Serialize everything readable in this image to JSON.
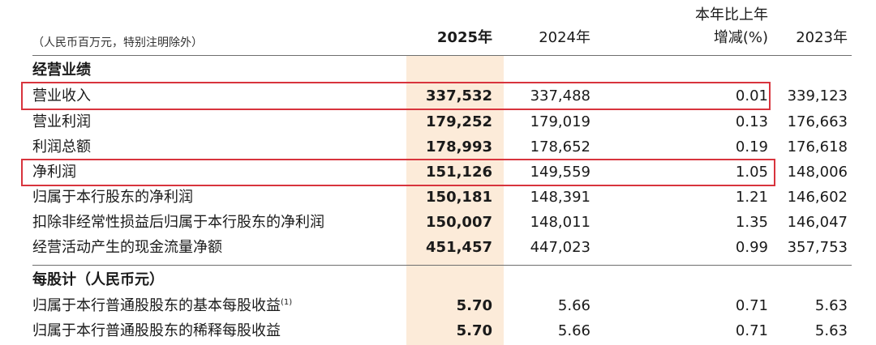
{
  "header": {
    "unit_note": "（人民币百万元，特别注明除外）",
    "col_2025": "2025年",
    "col_2024": "2024年",
    "col_change_line1": "本年比上年",
    "col_change_line2": "增减(%)",
    "col_2023": "2023年"
  },
  "sections": {
    "operating": "经营业绩",
    "per_share": "每股计（人民币元）"
  },
  "rows": [
    {
      "label": "营业收入",
      "v2025": "337,532",
      "v2024": "337,488",
      "change": "0.01",
      "v2023": "339,123"
    },
    {
      "label": "营业利润",
      "v2025": "179,252",
      "v2024": "179,019",
      "change": "0.13",
      "v2023": "176,663"
    },
    {
      "label": "利润总额",
      "v2025": "178,993",
      "v2024": "178,652",
      "change": "0.19",
      "v2023": "176,618"
    },
    {
      "label": "净利润",
      "v2025": "151,126",
      "v2024": "149,559",
      "change": "1.05",
      "v2023": "148,006"
    },
    {
      "label": "归属于本行股东的净利润",
      "v2025": "150,181",
      "v2024": "148,391",
      "change": "1.21",
      "v2023": "146,602"
    },
    {
      "label": "扣除非经常性损益后归属于本行股东的净利润",
      "v2025": "150,007",
      "v2024": "148,011",
      "change": "1.35",
      "v2023": "146,047"
    },
    {
      "label": "经营活动产生的现金流量净额",
      "v2025": "451,457",
      "v2024": "447,023",
      "change": "0.99",
      "v2023": "357,753"
    }
  ],
  "per_share_rows": [
    {
      "label": "归属于本行普通股股东的基本每股收益",
      "footnote": "(1)",
      "v2025": "5.70",
      "v2024": "5.66",
      "change": "0.71",
      "v2023": "5.63"
    },
    {
      "label": "归属于本行普通股股东的稀释每股收益",
      "v2025": "5.70",
      "v2024": "5.66",
      "change": "0.71",
      "v2023": "5.63"
    }
  ],
  "colors": {
    "highlight_column": "#fcebd9",
    "frame": "#d8343d"
  }
}
